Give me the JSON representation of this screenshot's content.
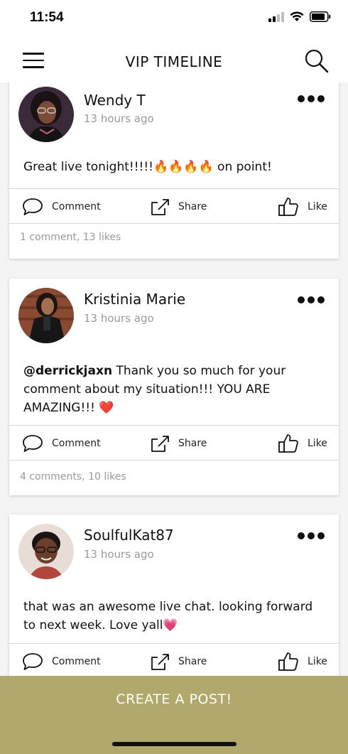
{
  "status_bar": {
    "time": "11:54"
  },
  "header": {
    "title": "VIP TIMELINE"
  },
  "actions": {
    "comment_label": "Comment",
    "share_label": "Share",
    "like_label": "Like"
  },
  "posts": [
    {
      "author": "Wendy T",
      "time": "13 hours ago",
      "text": "Great live tonight!!!!!🔥🔥🔥🔥 on point!",
      "stats": "1 comment,  13 likes"
    },
    {
      "author": "Kristinia Marie",
      "time": "13 hours ago",
      "mention": "@derrickjaxn",
      "text": " Thank you so much for your comment about my situation!!! YOU ARE AMAZING!!! ❤️",
      "stats": "4 comments,  10 likes"
    },
    {
      "author": "SoulfulKat87",
      "time": "13 hours ago",
      "text": "that was an awesome live chat. looking forward to next week. Love yall💗",
      "stats": ""
    }
  ],
  "create_post": {
    "label": "CREATE A POST!"
  },
  "colors": {
    "accent": "#b1a86b",
    "muted_text": "#9a9a9a"
  }
}
